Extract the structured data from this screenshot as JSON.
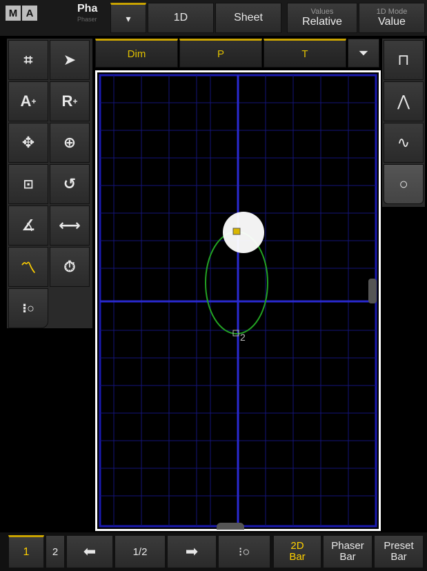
{
  "topbar": {
    "logo_m": "M",
    "logo_a": "A",
    "phaser_title": "Pha",
    "phaser_sub": "Phaser",
    "dropdown_icon": "triangle-down-icon",
    "btn_1d": "1D",
    "btn_sheet": "Sheet",
    "values_label": "Values",
    "values_value": "Relative",
    "mode_label": "1D Mode",
    "mode_value": "Value"
  },
  "features": {
    "dim": "Dim",
    "p": "P",
    "t": "T",
    "filter_icon": "filter-icon"
  },
  "tools": {
    "icons": [
      "add-grid-icon",
      "cursor-arrow-icon",
      "absolute-plus-icon",
      "relative-plus-icon",
      "move-icon",
      "target-icon",
      "fit-icon",
      "rotate-icon",
      "angle-icon",
      "width-icon",
      "wave-icon",
      "timer-icon",
      "phaser-icon"
    ],
    "absolute_label": "A",
    "relative_label": "R",
    "plus_sup": "+"
  },
  "shapes": {
    "icons": [
      "square-wave-icon",
      "zigzag-icon",
      "sine-icon",
      "circle-icon"
    ]
  },
  "canvas": {
    "point_label": "2"
  },
  "bottombar": {
    "page1": "1",
    "page2": "2",
    "page_indicator": "1/2",
    "btn_2d_line1": "2D",
    "btn_2d_line2": "Bar",
    "phaser_bar_line1": "Phaser",
    "phaser_bar_line2": "Bar",
    "preset_bar_line1": "Preset",
    "preset_bar_line2": "Bar"
  },
  "colors": {
    "accent": "#ffd000",
    "grid": "#1a1aa0",
    "axis": "#2a2acc",
    "path": "#23a323"
  }
}
